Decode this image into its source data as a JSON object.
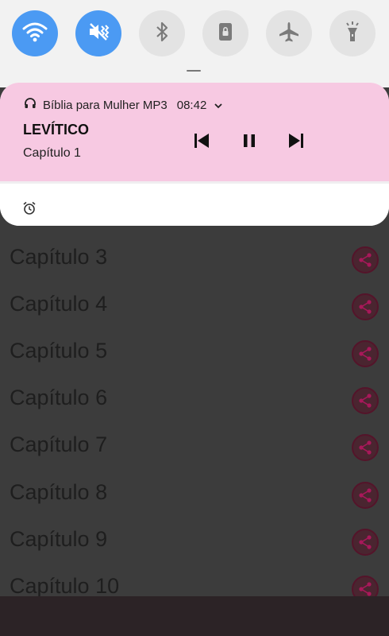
{
  "quick_settings": {
    "tiles": [
      {
        "name": "wifi-icon",
        "state": "on"
      },
      {
        "name": "vibrate-icon",
        "state": "on"
      },
      {
        "name": "bluetooth-icon",
        "state": "off"
      },
      {
        "name": "portrait-lock-icon",
        "state": "off"
      },
      {
        "name": "airplane-mode-icon",
        "state": "off"
      },
      {
        "name": "flashlight-icon",
        "state": "off"
      }
    ],
    "accent_color": "#4b9af3"
  },
  "notification": {
    "app_icon": "headphones-icon",
    "app_name": "Bíblia para Mulher MP3",
    "time": "08:42",
    "title": "LEVÍTICO",
    "subtitle": "Capítulo 1",
    "background_color": "#f7c9e2",
    "controls": [
      "skip-previous-icon",
      "pause-icon",
      "skip-next-icon"
    ],
    "footer_icon": "alarm-icon"
  },
  "chapter_list": {
    "items": [
      {
        "label": "Capítulo 3"
      },
      {
        "label": "Capítulo 4"
      },
      {
        "label": "Capítulo 5"
      },
      {
        "label": "Capítulo 6"
      },
      {
        "label": "Capítulo 7"
      },
      {
        "label": "Capítulo 8"
      },
      {
        "label": "Capítulo 9"
      },
      {
        "label": "Capítulo 10"
      }
    ],
    "share_icon": "share-icon"
  }
}
